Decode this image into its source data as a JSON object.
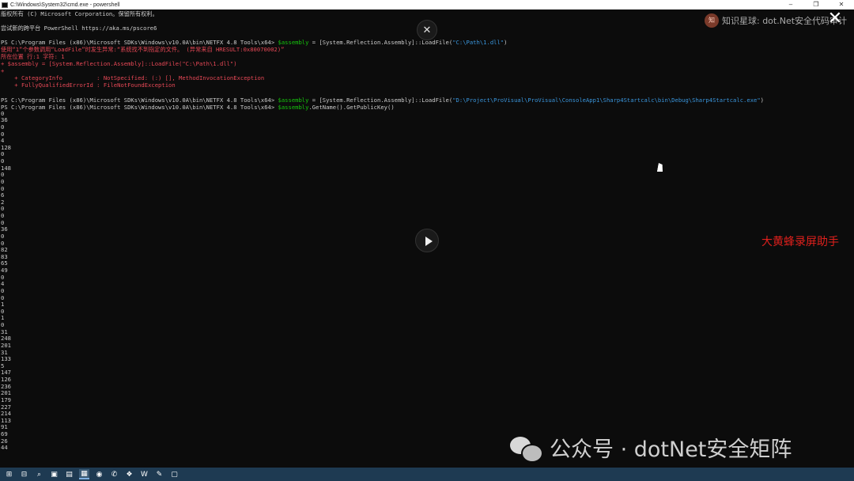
{
  "window": {
    "title": "C:\\Windows\\System32\\cmd.exe - powershell",
    "minimize_glyph": "–",
    "restore_glyph": "❐",
    "close_glyph": "✕"
  },
  "console": {
    "lines": [
      {
        "t": "版权所有 (C) Microsoft Corporation。保留所有权利。",
        "c": "c-white"
      },
      {
        "t": "",
        "c": "c-white"
      },
      {
        "t": "尝试新的跨平台 PowerShell https://aka.ms/pscore6",
        "c": "c-white"
      },
      {
        "t": "",
        "c": "c-white"
      },
      {
        "t": "PS C:\\Program Files (x86)\\Microsoft SDKs\\Windows\\v10.0A\\bin\\NETFX 4.8 Tools\\x64> $assembly = [System.Reflection.Assembly]::LoadFile(\"C:\\Path\\1.dll\")",
        "c": "c-white"
      },
      {
        "t": "使用“1”个参数调用“LoadFile”时发生异常:“系统找不到指定的文件。 (异常来自 HRESULT:0x80070002)”",
        "c": "c-red"
      },
      {
        "t": "所在位置 行:1 字符: 1",
        "c": "c-red"
      },
      {
        "t": "+ $assembly = [System.Reflection.Assembly]::LoadFile(\"C:\\Path\\1.dll\")",
        "c": "c-red"
      },
      {
        "t": "+ ",
        "c": "c-red"
      },
      {
        "t": "    + CategoryInfo          : NotSpecified: (:) [], MethodInvocationException",
        "c": "c-red"
      },
      {
        "t": "    + FullyQualifiedErrorId : FileNotFoundException",
        "c": "c-red"
      },
      {
        "t": "",
        "c": "c-white"
      },
      {
        "t": "PS C:\\Program Files (x86)\\Microsoft SDKs\\Windows\\v10.0A\\bin\\NETFX 4.8 Tools\\x64> $assembly = [System.Reflection.Assembly]::LoadFile(\"D:\\Project\\ProVisual\\ProVisual\\ConsoleApp1\\Sharp4Startcalc\\bin\\Debug\\Sharp4Startcalc.exe\")",
        "c": "c-white"
      },
      {
        "t": "PS C:\\Program Files (x86)\\Microsoft SDKs\\Windows\\v10.0A\\bin\\NETFX 4.8 Tools\\x64> $assembly.GetName().GetPublicKey()",
        "c": "c-white"
      }
    ],
    "numbers": [
      "0",
      "36",
      "0",
      "0",
      "4",
      "128",
      "0",
      "0",
      "148",
      "0",
      "0",
      "0",
      "6",
      "2",
      "0",
      "0",
      "0",
      "36",
      "0",
      "0",
      "82",
      "83",
      "65",
      "49",
      "0",
      "4",
      "0",
      "0",
      "1",
      "0",
      "1",
      "0",
      "31",
      "248",
      "201",
      "31",
      "133",
      "5",
      "147",
      "126",
      "236",
      "201",
      "179",
      "227",
      "214",
      "113",
      "91",
      "69",
      "26",
      "44"
    ]
  },
  "overlay": {
    "close_glyph": "✕",
    "big_close_glyph": "✕",
    "watermark_top": "知识星球: dot.Net安全代码审计",
    "watermark_badge": "知",
    "recorder_label": "大黄蜂录屏助手",
    "wechat_label": "公众号 · dotNet安全矩阵"
  },
  "taskbar": {
    "items": [
      "⊞",
      "⊟",
      "⌕",
      "▣",
      "▤",
      "▦",
      "◉",
      "✆",
      "❖",
      "W",
      "✎",
      "▢"
    ]
  }
}
